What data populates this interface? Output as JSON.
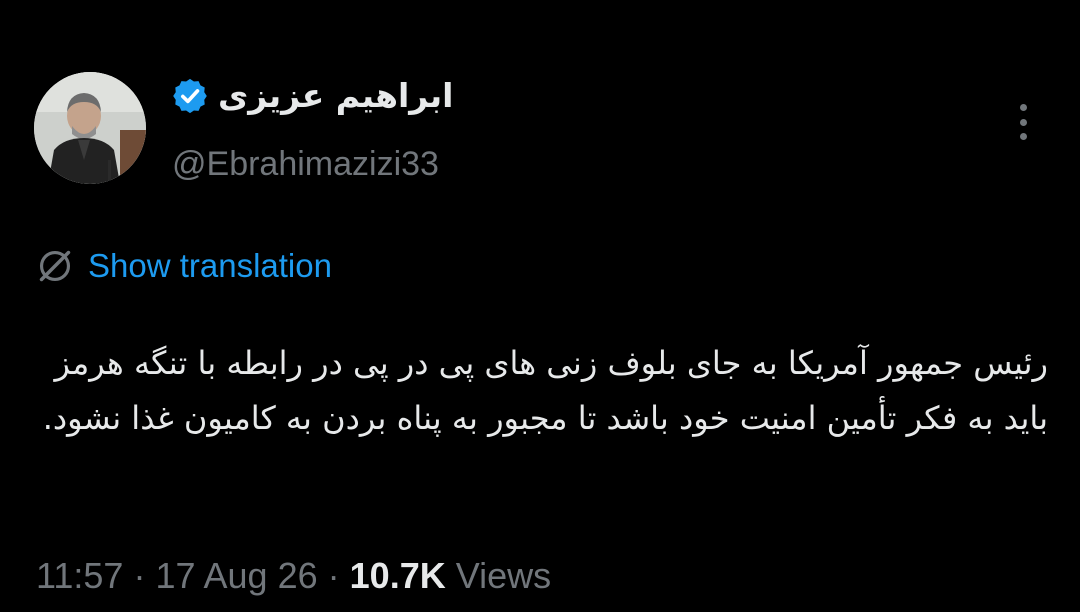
{
  "author": {
    "display_name": "ابراهیم عزیزی",
    "handle": "@Ebrahimazizi33",
    "verified": true,
    "avatar_icon": "profile-photo"
  },
  "translate": {
    "label": "Show translation",
    "icon": "translate-globe-icon"
  },
  "tweet": {
    "text": "رئیس جمهور آمریکا به جای بلوف زنی های پی در پی در رابطه با تنگه هرمز باید به فکر تأمین امنیت خود باشد تا مجبور به پناه بردن به کامیون غذا نشود."
  },
  "meta": {
    "time": "11:57",
    "sep1": "·",
    "date": "17 Aug 26",
    "sep2": "·",
    "views_count": "10.7K",
    "views_label": "Views"
  },
  "colors": {
    "background": "#000000",
    "text": "#e7e9ea",
    "secondary": "#71767b",
    "accent": "#1d9bf0"
  }
}
